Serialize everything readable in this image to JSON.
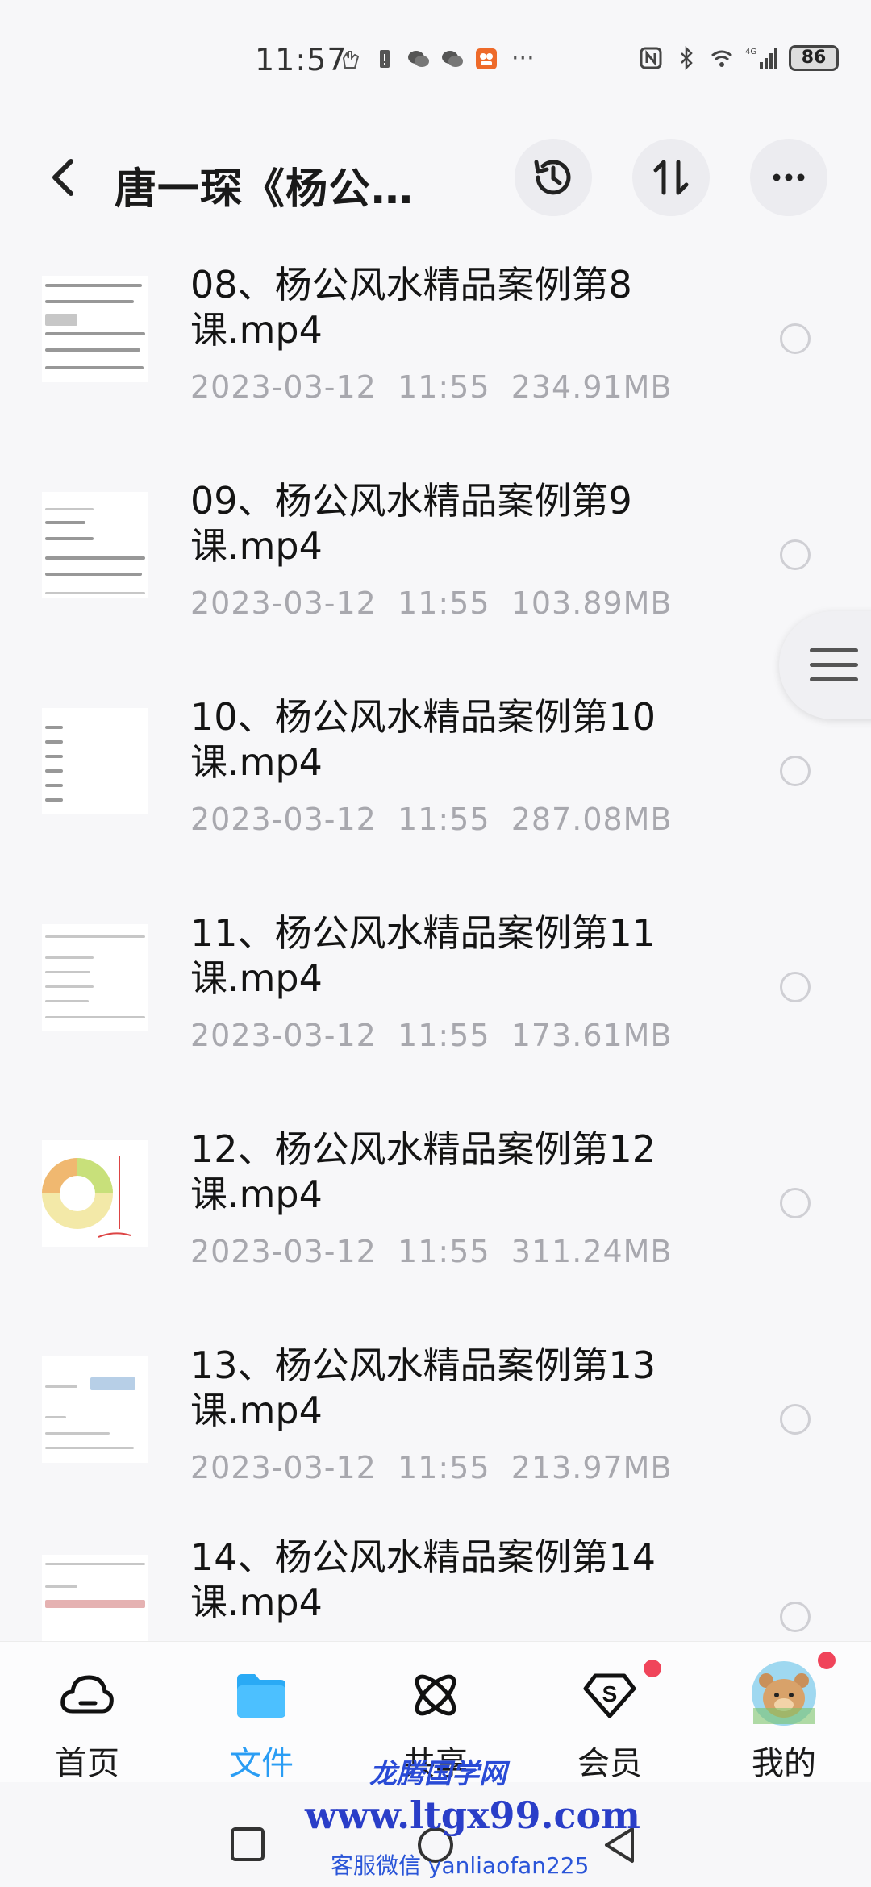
{
  "status_bar": {
    "time": "11:57",
    "battery": "86",
    "network": "4G"
  },
  "header": {
    "title": "唐一琛《杨公…"
  },
  "files": [
    {
      "name": "08、杨公风水精品案例第8课.mp4",
      "date": "2023-03-12",
      "time": "11:55",
      "size": "234.91MB"
    },
    {
      "name": "09、杨公风水精品案例第9课.mp4",
      "date": "2023-03-12",
      "time": "11:55",
      "size": "103.89MB"
    },
    {
      "name": "10、杨公风水精品案例第10课.mp4",
      "date": "2023-03-12",
      "time": "11:55",
      "size": "287.08MB"
    },
    {
      "name": "11、杨公风水精品案例第11课.mp4",
      "date": "2023-03-12",
      "time": "11:55",
      "size": "173.61MB"
    },
    {
      "name": "12、杨公风水精品案例第12课.mp4",
      "date": "2023-03-12",
      "time": "11:55",
      "size": "311.24MB"
    },
    {
      "name": "13、杨公风水精品案例第13课.mp4",
      "date": "2023-03-12",
      "time": "11:55",
      "size": "213.97MB"
    },
    {
      "name": "14、杨公风水精品案例第14课.mp4",
      "date": "",
      "time": "",
      "size": ""
    }
  ],
  "bottom_nav": [
    {
      "label": "首页",
      "icon": "cloud-icon"
    },
    {
      "label": "文件",
      "icon": "folder-icon"
    },
    {
      "label": "共享",
      "icon": "atom-icon"
    },
    {
      "label": "会员",
      "icon": "vip-icon"
    },
    {
      "label": "我的",
      "icon": "avatar-icon"
    }
  ],
  "watermark": {
    "line1": "龙腾国学网",
    "line2": "www.ltgx99.com",
    "line3": "客服微信 yanliaofan225"
  },
  "colors": {
    "accent": "#2a9df4",
    "badge": "#f0445a",
    "meta_text": "#a8a8ae"
  }
}
